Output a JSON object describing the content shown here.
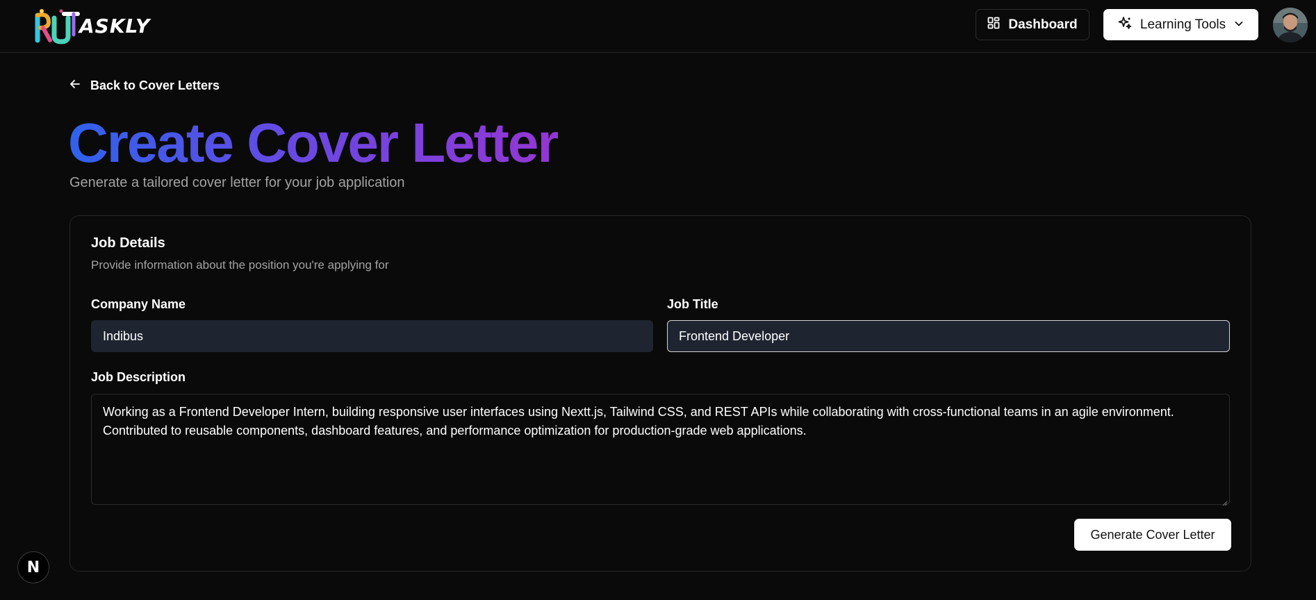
{
  "header": {
    "logo_text": "ASKLY",
    "dashboard_label": "Dashboard",
    "tools_label": "Learning Tools"
  },
  "nav": {
    "back_label": "Back to Cover Letters"
  },
  "page": {
    "title": "Create Cover Letter",
    "subtitle": "Generate a tailored cover letter for your job application"
  },
  "card": {
    "title": "Job Details",
    "description": "Provide information about the position you're applying for",
    "company_label": "Company Name",
    "company_value": "Indibus",
    "job_title_label": "Job Title",
    "job_title_value": "Frontend Developer",
    "job_description_label": "Job Description",
    "job_description_value": "Working as a Frontend Developer Intern, building responsive user interfaces using Nextt.js, Tailwind CSS, and REST APIs while collaborating with cross-functional teams in an agile environment. Contributed to reusable components, dashboard features, and performance optimization for production-grade web applications.",
    "generate_label": "Generate Cover Letter"
  },
  "badge": {
    "letter": "N"
  },
  "colors": {
    "background": "#0a0a0a",
    "input_bg": "#1e2530",
    "gradient_start": "#2f62ec",
    "gradient_end": "#9436d2"
  }
}
